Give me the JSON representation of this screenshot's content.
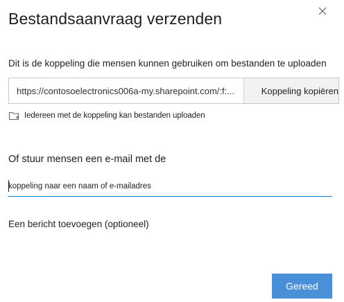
{
  "dialog": {
    "title": "Bestandsaanvraag verzenden",
    "close_icon": "close-icon"
  },
  "link_section": {
    "description": "Dit is de koppeling die mensen kunnen gebruiken om bestanden te uploaden",
    "url": "https://contosoelectronics006a-my.sharepoint.com/:f:...",
    "copy_label": "Koppeling kopiëren",
    "permission_icon": "folder-icon",
    "permission_text": "Iedereen met de koppeling kan bestanden uploaden"
  },
  "email_section": {
    "heading": "Of stuur mensen een e-mail met de",
    "placeholder": "koppeling naar een naam of e-mailadres",
    "value": ""
  },
  "message": {
    "label": "Een bericht toevoegen (optioneel)"
  },
  "footer": {
    "done_label": "Gereed"
  },
  "colors": {
    "accent": "#0078d4",
    "button": "#4a90d9",
    "copy_bg": "#f3f2f1"
  }
}
